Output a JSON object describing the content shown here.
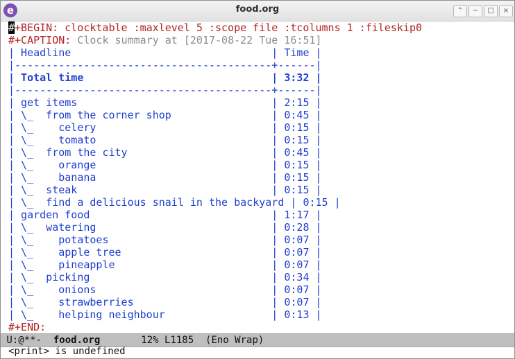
{
  "window": {
    "title": "food.org",
    "buttons": {
      "up": "⌃",
      "minimize": "−",
      "maximize": "□",
      "close": "×"
    }
  },
  "org": {
    "begin_line": "#+BEGIN: clocktable :maxlevel 5 :scope file :tcolumns 1 :fileskip0",
    "caption_label": "#+CAPTION:",
    "caption_text": " Clock summary at [2017-08-22 Tue 16:51]",
    "header": "| Headline                                | Time |",
    "separator": "|-----------------------------------------+------|",
    "total": "| Total time                              | 3:32 |",
    "rows": [
      "| get items                               | 2:15 |",
      "| \\_  from the corner shop                | 0:45 |",
      "| \\_    celery                            | 0:15 |",
      "| \\_    tomato                            | 0:15 |",
      "| \\_  from the city                       | 0:45 |",
      "| \\_    orange                            | 0:15 |",
      "| \\_    banana                            | 0:15 |",
      "| \\_  steak                               | 0:15 |",
      "| \\_  find a delicious snail in the backyard | 0:15 |",
      "| garden food                             | 1:17 |",
      "| \\_  watering                            | 0:28 |",
      "| \\_    potatoes                          | 0:07 |",
      "| \\_    apple tree                        | 0:07 |",
      "| \\_    pineapple                         | 0:07 |",
      "| \\_  picking                             | 0:34 |",
      "| \\_    onions                            | 0:07 |",
      "| \\_    strawberries                      | 0:07 |",
      "| \\_    helping neighbour                 | 0:13 |"
    ],
    "end_line": "#+END:"
  },
  "modeline": {
    "state": " U:@**-  ",
    "buffer": "food.org",
    "position": "       12% L1185  ",
    "mode": "(Eno Wrap)"
  },
  "echo_area": "<print> is undefined"
}
